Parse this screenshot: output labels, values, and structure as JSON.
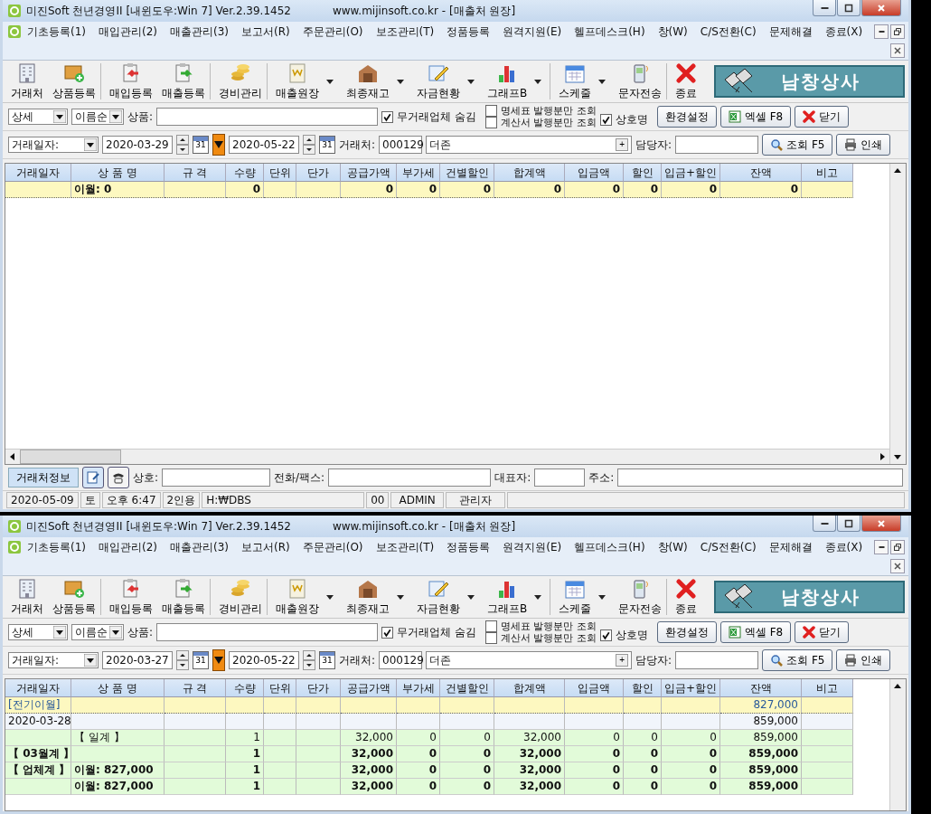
{
  "windows": [
    {
      "title": "미진Soft 천년경영II [내윈도우:Win 7] Ver.2.39.1452",
      "title_site": "www.mijinsoft.co.kr - [매출처 원장]",
      "menu": [
        "기초등록(1)",
        "매입관리(2)",
        "매출관리(3)",
        "보고서(R)",
        "주문관리(O)",
        "보조관리(T)",
        "정품등록",
        "원격지원(E)",
        "헬프데스크(H)",
        "창(W)",
        "C/S전환(C)",
        "문제해결",
        "종료(X)"
      ],
      "toolbar": [
        {
          "label": "거래처",
          "dropdown": false,
          "separator_after": false
        },
        {
          "label": "상품등록",
          "dropdown": false,
          "separator_after": true
        },
        {
          "label": "매입등록",
          "dropdown": false,
          "separator_after": false
        },
        {
          "label": "매출등록",
          "dropdown": false,
          "separator_after": true
        },
        {
          "label": "경비관리",
          "dropdown": false,
          "separator_after": true
        },
        {
          "label": "매출원장",
          "dropdown": true,
          "separator_after": false
        },
        {
          "label": "최종재고",
          "dropdown": true,
          "separator_after": false
        },
        {
          "label": "자금현황",
          "dropdown": true,
          "separator_after": false
        },
        {
          "label": "그래프B",
          "dropdown": true,
          "separator_after": true
        },
        {
          "label": "스케줄",
          "dropdown": true,
          "separator_after": false
        },
        {
          "label": "문자전송",
          "dropdown": false,
          "separator_after": true
        },
        {
          "label": "종료",
          "dropdown": false,
          "separator_after": false
        }
      ],
      "brand": "남창상사",
      "filter": {
        "view": "상세",
        "sort": "이름순",
        "product_label": "상품:",
        "hide_inactive": {
          "label": "무거래업체 숨김",
          "checked": true
        },
        "statement_only": {
          "label": "명세표 발행분만 조회",
          "checked": false
        },
        "invoice_only": {
          "label": "계산서 발행분만 조회",
          "checked": false
        },
        "company_name": {
          "label": "상호명",
          "checked": true
        },
        "buttons": [
          "환경설정",
          "엑셀 F8",
          "닫기"
        ]
      },
      "search": {
        "date_type": "거래일자:",
        "dates": [
          {
            "value": "2020-03-29",
            "calendar": "31"
          },
          {
            "value": "2020-05-22",
            "calendar": "31"
          }
        ],
        "client_label": "거래처:",
        "client_code": "000129",
        "client_name": "더존",
        "plus": "+",
        "manager_label": "담당자:",
        "buttons": [
          "조회 F5",
          "인쇄"
        ]
      },
      "table": {
        "columns": [
          "거래일자",
          "상 품 명",
          "규 격",
          "수량",
          "단위",
          "단가",
          "공급가액",
          "부가세",
          "건별할인",
          "합계액",
          "입금액",
          "할인",
          "입금+할인",
          "잔액",
          "비고"
        ],
        "rows": [
          {
            "kind": "carry",
            "bold": true,
            "cells": [
              "",
              "이월: 0",
              "",
              "0",
              "",
              "",
              "0",
              "0",
              "0",
              "0",
              "0",
              "0",
              "0",
              "0",
              ""
            ]
          }
        ]
      },
      "info_bar": {
        "tab": "거래처정보",
        "fields": [
          "상호:",
          "전화/팩스:",
          "대표자:",
          "주소:"
        ]
      },
      "status_bar": [
        "2020-05-09",
        "토",
        "오후 6:47",
        "2인용",
        "H:₩DBS",
        "00",
        "ADMIN",
        "관리자"
      ]
    },
    {
      "title": "미진Soft 천년경영II [내윈도우:Win 7] Ver.2.39.1452",
      "title_site": "www.mijinsoft.co.kr - [매출처 원장]",
      "menu": [
        "기초등록(1)",
        "매입관리(2)",
        "매출관리(3)",
        "보고서(R)",
        "주문관리(O)",
        "보조관리(T)",
        "정품등록",
        "원격지원(E)",
        "헬프데스크(H)",
        "창(W)",
        "C/S전환(C)",
        "문제해결",
        "종료(X)"
      ],
      "toolbar": [
        {
          "label": "거래처",
          "dropdown": false,
          "separator_after": false
        },
        {
          "label": "상품등록",
          "dropdown": false,
          "separator_after": true
        },
        {
          "label": "매입등록",
          "dropdown": false,
          "separator_after": false
        },
        {
          "label": "매출등록",
          "dropdown": false,
          "separator_after": true
        },
        {
          "label": "경비관리",
          "dropdown": false,
          "separator_after": true
        },
        {
          "label": "매출원장",
          "dropdown": true,
          "separator_after": false
        },
        {
          "label": "최종재고",
          "dropdown": true,
          "separator_after": false
        },
        {
          "label": "자금현황",
          "dropdown": true,
          "separator_after": false
        },
        {
          "label": "그래프B",
          "dropdown": true,
          "separator_after": true
        },
        {
          "label": "스케줄",
          "dropdown": true,
          "separator_after": false
        },
        {
          "label": "문자전송",
          "dropdown": false,
          "separator_after": true
        },
        {
          "label": "종료",
          "dropdown": false,
          "separator_after": false
        }
      ],
      "brand": "남창상사",
      "filter": {
        "view": "상세",
        "sort": "이름순",
        "product_label": "상품:",
        "hide_inactive": {
          "label": "무거래업체 숨김",
          "checked": true
        },
        "statement_only": {
          "label": "명세표 발행분만 조회",
          "checked": false
        },
        "invoice_only": {
          "label": "계산서 발행분만 조회",
          "checked": false
        },
        "company_name": {
          "label": "상호명",
          "checked": true
        },
        "buttons": [
          "환경설정",
          "엑셀 F8",
          "닫기"
        ]
      },
      "search": {
        "date_type": "거래일자:",
        "dates": [
          {
            "value": "2020-03-27",
            "calendar": "31"
          },
          {
            "value": "2020-05-22",
            "calendar": "31"
          }
        ],
        "client_label": "거래처:",
        "client_code": "000129",
        "client_name": "더존",
        "plus": "+",
        "manager_label": "담당자:",
        "buttons": [
          "조회 F5",
          "인쇄"
        ]
      },
      "table": {
        "columns": [
          "거래일자",
          "상 품 명",
          "규 격",
          "수량",
          "단위",
          "단가",
          "공급가액",
          "부가세",
          "건별할인",
          "합계액",
          "입금액",
          "할인",
          "입금+할인",
          "잔액",
          "비고"
        ],
        "rows": [
          {
            "kind": "opening",
            "bold": false,
            "cells": [
              "[전기이월]",
              "",
              "",
              "",
              "",
              "",
              "",
              "",
              "",
              "",
              "",
              "",
              "",
              "827,000",
              ""
            ]
          },
          {
            "kind": "detail",
            "bold": false,
            "cells": [
              "2020-03-28",
              "",
              "",
              "",
              "",
              "",
              "",
              "",
              "",
              "",
              "",
              "",
              "",
              "859,000",
              ""
            ]
          },
          {
            "kind": "sum",
            "bold": false,
            "cells": [
              "",
              "【 일계 】",
              "",
              "1",
              "",
              "",
              "32,000",
              "0",
              "0",
              "32,000",
              "0",
              "0",
              "0",
              "859,000",
              ""
            ]
          },
          {
            "kind": "sum",
            "bold": true,
            "cells": [
              "【 03월계 】",
              "",
              "",
              "1",
              "",
              "",
              "32,000",
              "0",
              "0",
              "32,000",
              "0",
              "0",
              "0",
              "859,000",
              ""
            ]
          },
          {
            "kind": "sum",
            "bold": true,
            "cells": [
              "【 업체계 】",
              "이월: 827,000",
              "",
              "1",
              "",
              "",
              "32,000",
              "0",
              "0",
              "32,000",
              "0",
              "0",
              "0",
              "859,000",
              ""
            ]
          },
          {
            "kind": "sum",
            "bold": true,
            "cells": [
              "",
              "이월: 827,000",
              "",
              "1",
              "",
              "",
              "32,000",
              "0",
              "0",
              "32,000",
              "0",
              "0",
              "0",
              "859,000",
              ""
            ]
          }
        ]
      }
    }
  ]
}
